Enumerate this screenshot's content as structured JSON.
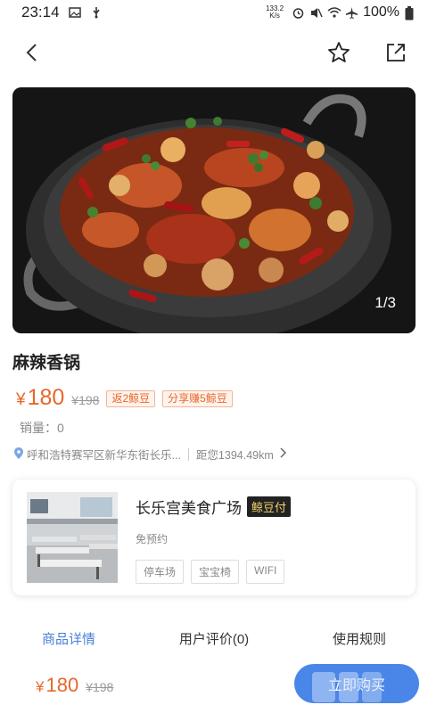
{
  "status_bar": {
    "time": "23:14",
    "net_speed": "133.2",
    "net_unit": "K/s",
    "battery": "100%"
  },
  "header": {
    "back_icon": "chevron-left-icon",
    "favorite_icon": "star-icon",
    "share_icon": "share-icon"
  },
  "hero": {
    "counter": "1/3"
  },
  "product": {
    "title": "麻辣香锅",
    "currency": "¥",
    "price": "180",
    "original_price": "¥198",
    "tag_return": "返2鲸豆",
    "tag_share": "分享赚5鲸豆",
    "sales_label": "销量：",
    "sales_value": "0",
    "address": "呼和浩特赛罕区新华东街长乐...",
    "distance": "距您1394.49km"
  },
  "store": {
    "name": "长乐宫美食广场",
    "pay_badge": "鲸豆付",
    "subtitle": "免预约",
    "facilities": [
      "停车场",
      "宝宝椅",
      "WIFI"
    ]
  },
  "tabs": [
    {
      "label": "商品详情",
      "active": true
    },
    {
      "label": "用户评价(0)",
      "active": false
    },
    {
      "label": "使用规则",
      "active": false
    }
  ],
  "bottom_bar": {
    "currency": "¥",
    "price": "180",
    "original_price": "¥198",
    "buy_label": "立即购买"
  },
  "colors": {
    "accent_price": "#e8672a",
    "tab_active": "#4a7fd8",
    "buy_button": "#4a86e8",
    "pay_badge_bg": "#222222",
    "pay_badge_text": "#f5d36b"
  }
}
